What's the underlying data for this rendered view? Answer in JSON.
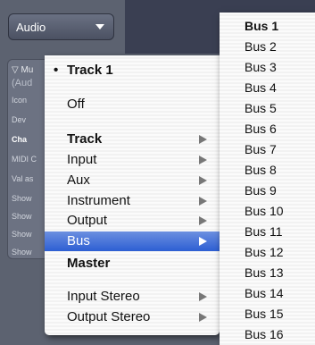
{
  "audio_select": {
    "value": "Audio"
  },
  "inspector": {
    "rows": [
      "▽ Mu",
      "(Aud",
      "Icon",
      "Dev",
      "Cha",
      "MIDI C",
      "Val as",
      "Show",
      "Show",
      "Show",
      "Show"
    ]
  },
  "menu": {
    "current": "Track 1",
    "off": "Off",
    "items": [
      {
        "label": "Track",
        "bold": true,
        "submenu": true
      },
      {
        "label": "Input",
        "submenu": true
      },
      {
        "label": "Aux",
        "submenu": true
      },
      {
        "label": "Instrument",
        "submenu": true
      },
      {
        "label": "Output",
        "submenu": true
      },
      {
        "label": "Bus",
        "submenu": true,
        "highlighted": true
      },
      {
        "label": "Master",
        "bold": true,
        "submenu": false
      }
    ],
    "stereo_items": [
      {
        "label": "Input Stereo",
        "submenu": true
      },
      {
        "label": "Output Stereo",
        "submenu": true
      }
    ],
    "highlight_color": "#3a68d6"
  },
  "bus_menu": {
    "items": [
      "Bus 1",
      "Bus 2",
      "Bus 3",
      "Bus 4",
      "Bus 5",
      "Bus 6",
      "Bus 7",
      "Bus 8",
      "Bus 9",
      "Bus 10",
      "Bus 11",
      "Bus 12",
      "Bus 13",
      "Bus 14",
      "Bus 15",
      "Bus 16"
    ],
    "selected_index": 0
  }
}
